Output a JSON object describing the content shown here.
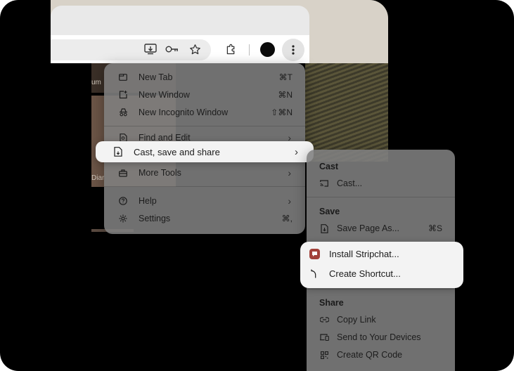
{
  "toolbar": {
    "icons": [
      "install-app-icon",
      "password-key-icon",
      "bookmark-star-icon",
      "extensions-icon",
      "profile-avatar",
      "more-menu-icon"
    ]
  },
  "page": {
    "caption_left_1": "um",
    "caption_left_2": "Diar"
  },
  "main_menu": {
    "items": [
      {
        "label": "New Tab",
        "shortcut": "⌘T",
        "icon": "new-tab-icon"
      },
      {
        "label": "New Window",
        "shortcut": "⌘N",
        "icon": "new-window-icon"
      },
      {
        "label": "New Incognito Window",
        "shortcut": "⇧⌘N",
        "icon": "incognito-icon"
      },
      {
        "label": "Find and Edit",
        "shortcut": "",
        "icon": "find-icon"
      },
      {
        "label": "Cast, save and share",
        "shortcut": "",
        "icon": "save-share-icon"
      },
      {
        "label": "More Tools",
        "shortcut": "",
        "icon": "toolbox-icon"
      },
      {
        "label": "Help",
        "shortcut": "",
        "icon": "help-icon"
      },
      {
        "label": "Settings",
        "shortcut": "⌘,",
        "icon": "settings-gear-icon"
      }
    ]
  },
  "sub_menu": {
    "cast_section": "Cast",
    "cast_item": "Cast...",
    "save_section": "Save",
    "save_page": "Save Page As...",
    "save_page_shortcut": "⌘S",
    "install_item": "Install Stripchat...",
    "shortcut_item": "Create Shortcut...",
    "share_section": "Share",
    "copy_link": "Copy Link",
    "send_devices": "Send to Your Devices",
    "qr_code": "Create QR Code"
  },
  "colors": {
    "menu_bg": "#808080",
    "highlight_bg": "#f3f3f3",
    "app_icon": "#a2413a"
  }
}
